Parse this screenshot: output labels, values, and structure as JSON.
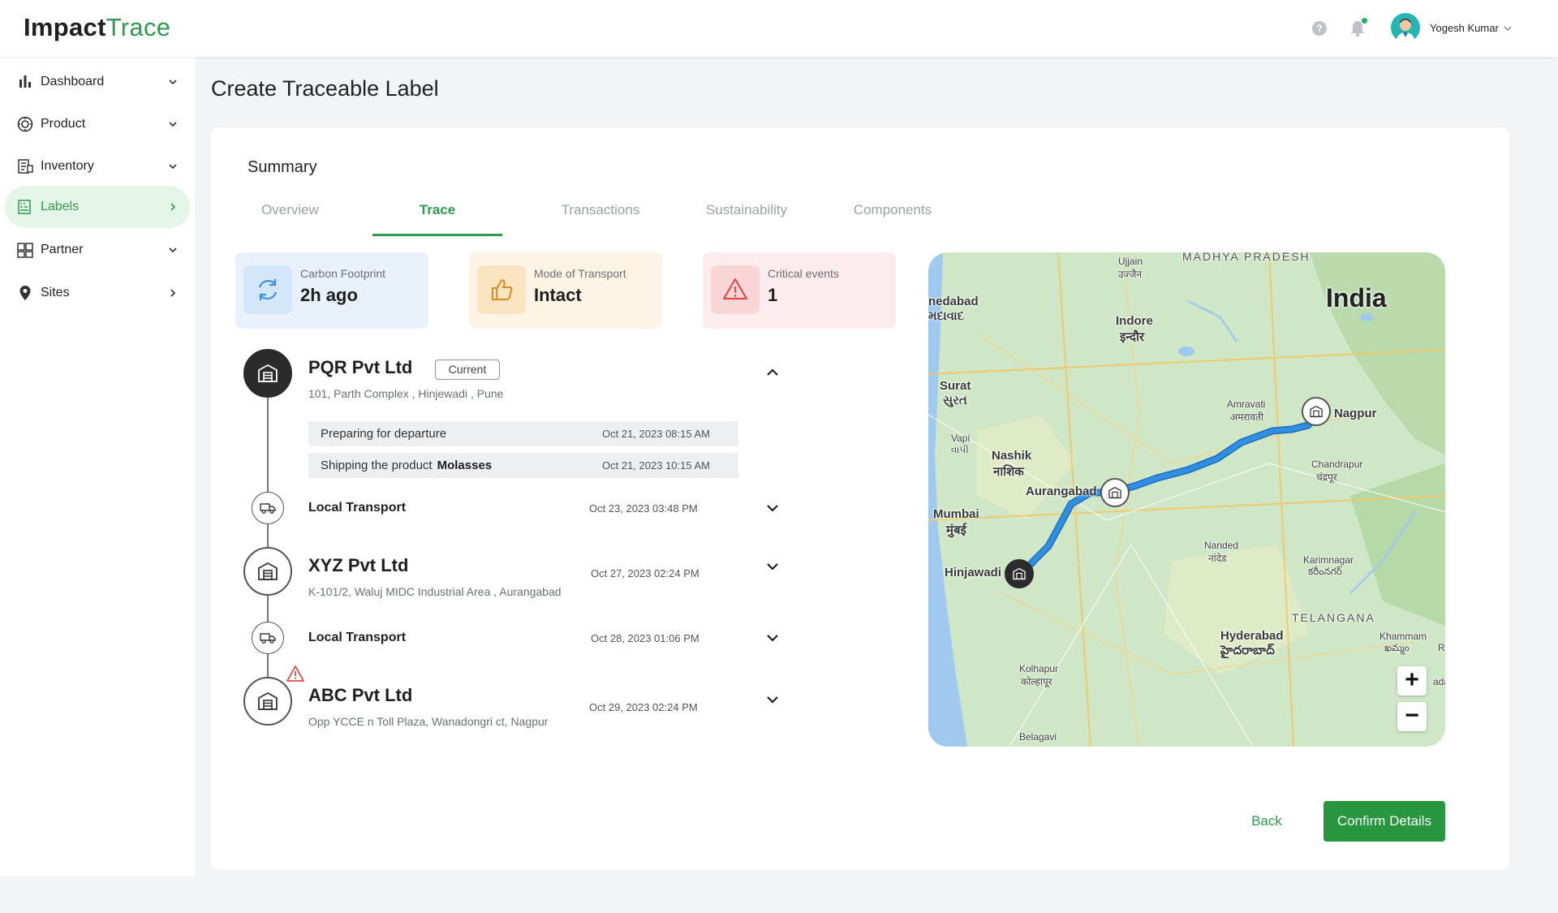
{
  "app": {
    "logo_part1": "Impact",
    "logo_part2": "Trace"
  },
  "header": {
    "help_glyph": "?",
    "user_name": "Yogesh Kumar"
  },
  "sidebar": {
    "items": [
      {
        "label": "Dashboard",
        "icon": "bar-chart-icon",
        "chevron": "down"
      },
      {
        "label": "Product",
        "icon": "product-icon",
        "chevron": "down"
      },
      {
        "label": "Inventory",
        "icon": "inventory-icon",
        "chevron": "down"
      },
      {
        "label": "Labels",
        "icon": "labels-icon",
        "chevron": "right",
        "active": true
      },
      {
        "label": "Partner",
        "icon": "partner-icon",
        "chevron": "down"
      },
      {
        "label": "Sites",
        "icon": "location-pin-icon",
        "chevron": "right"
      }
    ]
  },
  "page": {
    "title": "Create Traceable Label",
    "summary_title": "Summary"
  },
  "tabs": [
    {
      "label": "Overview"
    },
    {
      "label": "Trace",
      "active": true
    },
    {
      "label": "Transactions"
    },
    {
      "label": "Sustainability"
    },
    {
      "label": "Components"
    }
  ],
  "stats": [
    {
      "label": "Carbon Footprint",
      "value": "2h ago",
      "color": "#e9f2fb",
      "icon_bg": "#d3e6fa",
      "icon_color": "#3b8fd6",
      "icon": "refresh-icon"
    },
    {
      "label": "Mode of Transport",
      "value": "Intact",
      "color": "#fdf4e6",
      "icon_bg": "#fbe4c2",
      "icon_color": "#e08b1f",
      "icon": "thumbs-up-icon"
    },
    {
      "label": "Critical events",
      "value": "1",
      "color": "#fdeced",
      "icon_bg": "#fbd6d8",
      "icon_color": "#e04a4a",
      "icon": "warning-icon"
    }
  ],
  "trace": {
    "stop1": {
      "name": "PQR Pvt Ltd",
      "badge": "Current",
      "address": "101, Parth Complex , Hinjewadi , Pune",
      "events": [
        {
          "text": "Preparing for departure",
          "product": "",
          "date": "Oct 21, 2023 08:15 AM"
        },
        {
          "text": "Shipping the product",
          "product": "Molasses",
          "date": "Oct 21, 2023 10:15 AM"
        }
      ]
    },
    "transport1": {
      "label": "Local Transport",
      "date": "Oct 23, 2023 03:48 PM"
    },
    "stop2": {
      "name": "XYZ Pvt Ltd",
      "address": "K-101/2, Waluj MIDC Industrial Area , Aurangabad",
      "date": "Oct 27, 2023 02:24 PM"
    },
    "transport2": {
      "label": "Local Transport",
      "date": "Oct 28, 2023 01:06 PM"
    },
    "stop3": {
      "name": "ABC Pvt Ltd",
      "address": "Opp YCCE n Toll Plaza, Wanadongri ct, Nagpur",
      "date": "Oct 29, 2023 02:24 PM"
    }
  },
  "map": {
    "labels": {
      "country": "India",
      "region1": "MADHYA PRADESH",
      "region2": "TELANGANA",
      "ujjain": "Ujjain",
      "ujjain_local": "उज्जैन",
      "ahmedabad": "nedabad",
      "ahmedabad_local": "મદાવાદ",
      "indore": "Indore",
      "indore_local": "इन्दौर",
      "surat": "Surat",
      "surat_local": "સુરત",
      "vapi": "Vapi",
      "vapi_local": "વાપી",
      "nashik": "Nashik",
      "nashik_local": "नाशिक",
      "aurangabad": "Aurangabad",
      "mumbai": "Mumbai",
      "mumbai_local": "मुंबई",
      "hinjawadi": "Hinjawadi",
      "amravati": "Amravati",
      "amravati_local": "अमरावती",
      "nagpur": "Nagpur",
      "chandrapur": "Chandrapur",
      "chandrapur_local": "चंद्रपूर",
      "nanded": "Nanded",
      "nanded_local": "नांदेड",
      "karimnagar": "Karimnagar",
      "karimnagar_local": "కరీంనగర్",
      "hyderabad": "Hyderabad",
      "hyderabad_local": "హైదరాబాద్",
      "khammam": "Khammam",
      "khammam_local": "ఖమ్మం",
      "kolhapur": "Kolhapur",
      "kolhapur_local": "कोल्हापूर",
      "belagavi": "Belagavi",
      "edge_r": "R",
      "edge_ada": "ada"
    },
    "zoom_in": "+",
    "zoom_out": "−",
    "route_color": "#2f8fe0"
  },
  "actions": {
    "back": "Back",
    "confirm": "Confirm Details"
  }
}
